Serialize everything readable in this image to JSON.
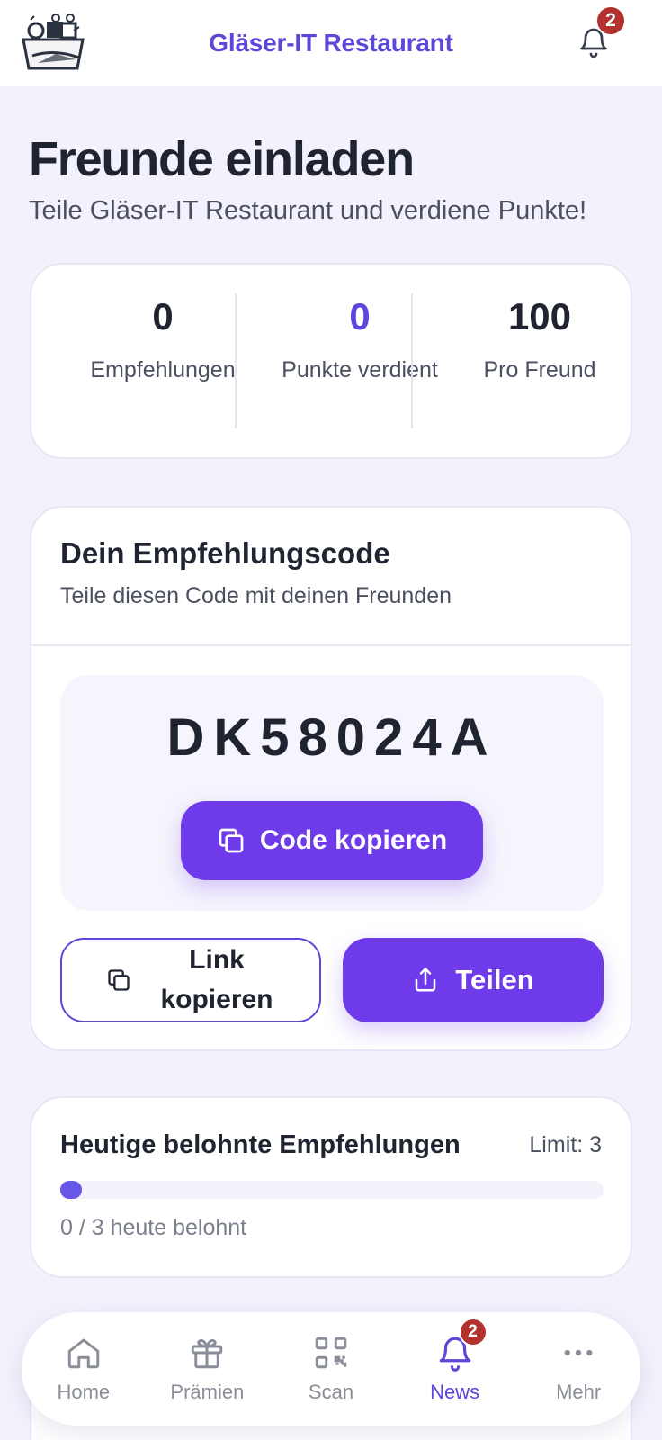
{
  "header": {
    "title": "Gläser-IT Restaurant",
    "notification_count": "2",
    "logo_icon": "gift-basket-logo",
    "bell_icon": "bell-icon"
  },
  "page": {
    "title": "Freunde einladen",
    "subtitle": "Teile Gläser-IT Restaurant und verdiene Punkte!"
  },
  "stats": [
    {
      "value": "0",
      "label": "Empfehlungen"
    },
    {
      "value": "0",
      "label": "Punkte verdient"
    },
    {
      "value": "100",
      "label": "Pro Freund"
    }
  ],
  "referral": {
    "title": "Dein Empfehlungscode",
    "subtitle": "Teile diesen Code mit deinen Freunden",
    "code": "DK58024A",
    "copy_code_label": "Code kopieren",
    "copy_link_label": "Link kopieren",
    "share_label": "Teilen"
  },
  "daily_limit": {
    "title": "Heutige belohnte Empfehlungen",
    "limit_label": "Limit: 3",
    "progress_text": "0 / 3 heute belohnt",
    "rewarded": 0,
    "limit": 3
  },
  "nav": {
    "items": [
      {
        "label": "Home",
        "icon": "home-icon"
      },
      {
        "label": "Prämien",
        "icon": "gift-icon"
      },
      {
        "label": "Scan",
        "icon": "qr-icon"
      },
      {
        "label": "News",
        "icon": "bell-icon",
        "badge": "2",
        "active": true
      },
      {
        "label": "Mehr",
        "icon": "more-icon"
      }
    ]
  },
  "colors": {
    "accent": "#5b47d9",
    "button": "#6e3aea",
    "badge": "#b3312f",
    "background": "#f3f2fc"
  }
}
